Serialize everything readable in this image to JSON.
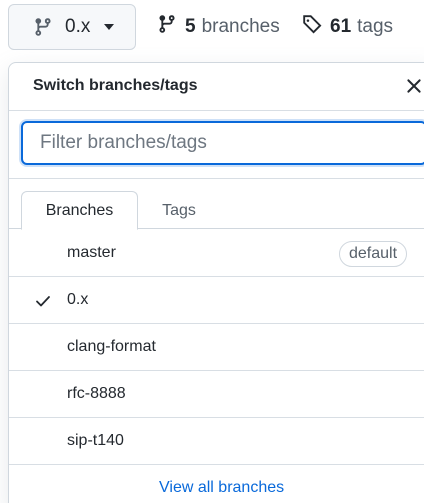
{
  "branch_button": {
    "label": "0.x",
    "icon": "git-branch-icon"
  },
  "branches_link": {
    "count": "5",
    "word": "branches",
    "icon": "git-branch-icon"
  },
  "tags_link": {
    "count": "61",
    "word": "tags",
    "icon": "tag-icon"
  },
  "panel": {
    "title": "Switch branches/tags",
    "close_icon": "close-icon",
    "filter_placeholder": "Filter branches/tags",
    "tabs": [
      {
        "label": "Branches",
        "selected": true
      },
      {
        "label": "Tags",
        "selected": false
      }
    ],
    "branches": [
      {
        "name": "master",
        "badge": "default",
        "selected": false
      },
      {
        "name": "0.x",
        "badge": "",
        "selected": true
      },
      {
        "name": "clang-format",
        "badge": "",
        "selected": false
      },
      {
        "name": "rfc-8888",
        "badge": "",
        "selected": false
      },
      {
        "name": "sip-t140",
        "badge": "",
        "selected": false
      }
    ],
    "footer_link": "View all branches"
  },
  "colors": {
    "accent": "#0969da",
    "border": "#d0d7de",
    "text": "#24292f",
    "muted": "#57606a"
  }
}
